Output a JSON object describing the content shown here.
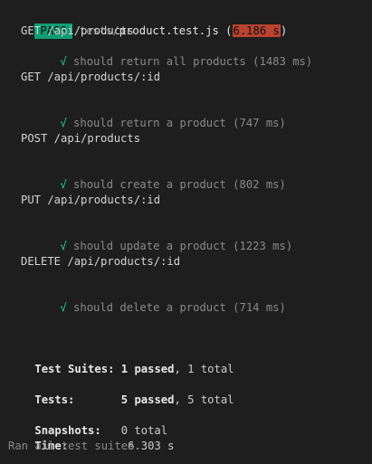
{
  "header": {
    "status": "PASS",
    "path_dir": "tests/",
    "path_file": "product.test.js",
    "paren_open": "(",
    "duration": "6.186 s",
    "paren_close": ")"
  },
  "groups": [
    {
      "title": "GET /api/products",
      "tests": [
        {
          "check": "√",
          "name": "should return all products",
          "time": "(1483 ms)"
        }
      ]
    },
    {
      "title": "GET /api/products/:id",
      "tests": [
        {
          "check": "√",
          "name": "should return a product",
          "time": "(747 ms)"
        }
      ]
    },
    {
      "title": "POST /api/products",
      "tests": [
        {
          "check": "√",
          "name": "should create a product",
          "time": "(802 ms)"
        }
      ]
    },
    {
      "title": "PUT /api/products/:id",
      "tests": [
        {
          "check": "√",
          "name": "should update a product",
          "time": "(1223 ms)"
        }
      ]
    },
    {
      "title": "DELETE /api/products/:id",
      "tests": [
        {
          "check": "√",
          "name": "should delete a product",
          "time": "(714 ms)"
        }
      ]
    }
  ],
  "summary": {
    "suites_label": "Test Suites:",
    "suites_passed": "1 passed",
    "suites_total": ", 1 total",
    "tests_label": "Tests:",
    "tests_passed": "5 passed",
    "tests_total": ", 5 total",
    "snapshots_label": "Snapshots:",
    "snapshots_value": "0 total",
    "time_label": "Time:",
    "time_value": "6.303 s",
    "footer": "Ran all test suites."
  },
  "colors": {
    "background": "#1e1e1e",
    "pass_badge": "#0f9d76",
    "duration_badge": "#b8432f",
    "success": "#23d18b"
  }
}
